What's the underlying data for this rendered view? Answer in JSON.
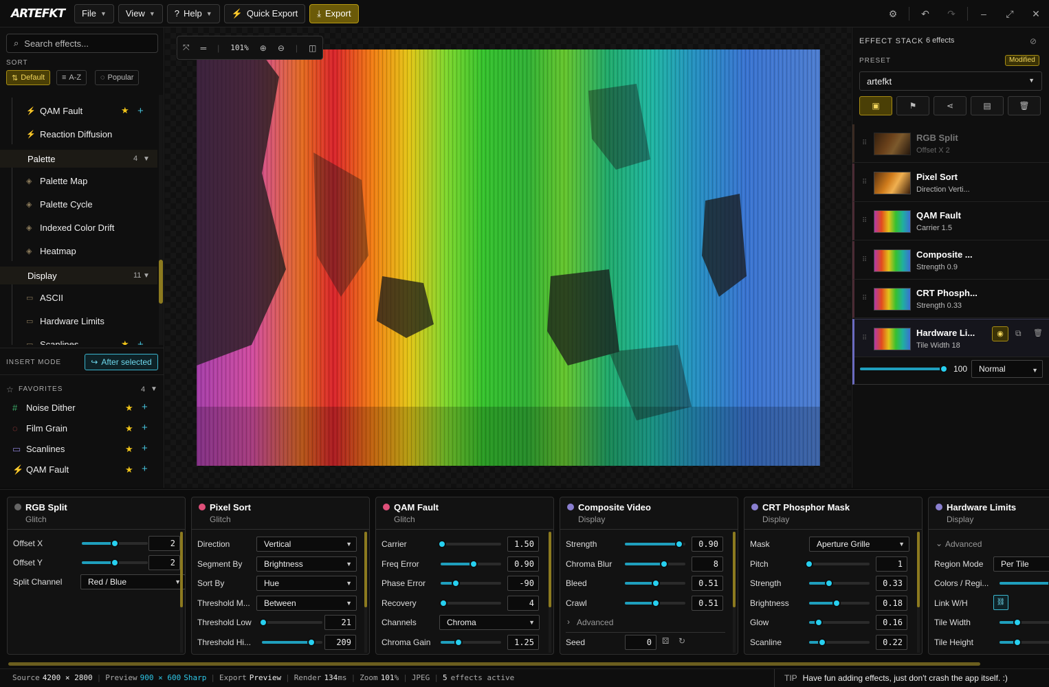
{
  "app": {
    "logo_text": "ARTEFKT"
  },
  "menu": {
    "file": "File",
    "view": "View",
    "help": "Help",
    "quick_export": "Quick Export",
    "export": "Export"
  },
  "colors": {
    "accent_gold": "#b79a13",
    "accent_cyan": "#27d0f0"
  },
  "left": {
    "search_placeholder": "Search effects...",
    "sort_label": "SORT",
    "sort": [
      "Default",
      "A-Z",
      "Popular"
    ],
    "tree": [
      {
        "kind": "item",
        "label": "QAM Fault",
        "icon": "bolt-icon",
        "fav": true
      },
      {
        "kind": "item",
        "label": "Reaction Diffusion",
        "icon": "bolt-icon",
        "fav": false
      },
      {
        "kind": "group",
        "label": "Palette",
        "count": "4"
      },
      {
        "kind": "item",
        "label": "Palette Map",
        "icon": "layers-icon"
      },
      {
        "kind": "item",
        "label": "Palette Cycle",
        "icon": "layers-icon"
      },
      {
        "kind": "item",
        "label": "Indexed Color Drift",
        "icon": "layers-icon"
      },
      {
        "kind": "item",
        "label": "Heatmap",
        "icon": "layers-icon"
      },
      {
        "kind": "group",
        "label": "Display",
        "count": "11"
      },
      {
        "kind": "item",
        "label": "ASCII",
        "icon": "monitor-icon"
      },
      {
        "kind": "item",
        "label": "Hardware Limits",
        "icon": "monitor-icon"
      },
      {
        "kind": "item",
        "label": "Scanlines",
        "icon": "monitor-icon",
        "fav": true
      }
    ],
    "insert_mode_label": "INSERT MODE",
    "insert_mode_value": "After selected",
    "favorites_label": "FAVORITES",
    "favorites_count": "4",
    "favorites": [
      {
        "label": "Noise Dither",
        "icon": "hash-icon",
        "color": "#3cae6a"
      },
      {
        "label": "Film Grain",
        "icon": "film-icon",
        "color": "#d24a4a"
      },
      {
        "label": "Scanlines",
        "icon": "monitor-icon",
        "color": "#8a7fd0"
      },
      {
        "label": "QAM Fault",
        "icon": "bolt-icon",
        "color": "#d24a7a"
      }
    ]
  },
  "canvas": {
    "zoom": "101%"
  },
  "right": {
    "stack_label": "EFFECT STACK",
    "stack_count": "6 effects",
    "preset_label": "PRESET",
    "modified_badge": "Modified",
    "preset_value": "artefkt",
    "stack": [
      {
        "name": "RGB Split",
        "sub": "Offset X 2",
        "dim": true
      },
      {
        "name": "Pixel Sort",
        "sub": "Direction Verti..."
      },
      {
        "name": "QAM Fault",
        "sub": "Carrier 1.5"
      },
      {
        "name": "Composite ...",
        "sub": "Strength 0.9"
      },
      {
        "name": "CRT Phosph...",
        "sub": "Strength 0.33"
      },
      {
        "name": "Hardware Li...",
        "sub": "Tile Width 18",
        "selected": true
      }
    ],
    "opacity": "100",
    "opacity_fraction": 1.0,
    "blend_mode": "Normal"
  },
  "cards": [
    {
      "title": "RGB Split",
      "sub": "Glitch",
      "dot": "#666666",
      "rows": [
        {
          "type": "slider",
          "label": "Offset X",
          "value": "2",
          "frac": 0.5
        },
        {
          "type": "slider",
          "label": "Offset Y",
          "value": "2",
          "frac": 0.5
        },
        {
          "type": "select",
          "label": "Split Channel",
          "value": "Red / Blue"
        }
      ]
    },
    {
      "title": "Pixel Sort",
      "sub": "Glitch",
      "dot": "#e0507a",
      "rows": [
        {
          "type": "select",
          "label": "Direction",
          "value": "Vertical"
        },
        {
          "type": "select",
          "label": "Segment By",
          "value": "Brightness"
        },
        {
          "type": "select",
          "label": "Sort By",
          "value": "Hue"
        },
        {
          "type": "select",
          "label": "Threshold M...",
          "value": "Between"
        },
        {
          "type": "slider",
          "label": "Threshold Low",
          "value": "21",
          "frac": 0.02
        },
        {
          "type": "slider",
          "label": "Threshold Hi...",
          "value": "209",
          "frac": 0.82
        }
      ]
    },
    {
      "title": "QAM Fault",
      "sub": "Glitch",
      "dot": "#e0507a",
      "rows": [
        {
          "type": "slider",
          "label": "Carrier",
          "value": "1.50",
          "frac": 0.02
        },
        {
          "type": "slider",
          "label": "Freq Error",
          "value": "0.90",
          "frac": 0.55
        },
        {
          "type": "slider",
          "label": "Phase Error",
          "value": "-90",
          "frac": 0.25
        },
        {
          "type": "slider",
          "label": "Recovery",
          "value": "4",
          "frac": 0.05
        },
        {
          "type": "select",
          "label": "Channels",
          "value": "Chroma"
        },
        {
          "type": "slider",
          "label": "Chroma Gain",
          "value": "1.25",
          "frac": 0.3
        }
      ]
    },
    {
      "title": "Composite Video",
      "sub": "Display",
      "dot": "#8a7fd0",
      "rows": [
        {
          "type": "slider",
          "label": "Strength",
          "value": "0.90",
          "frac": 0.9
        },
        {
          "type": "slider",
          "label": "Chroma Blur",
          "value": "8",
          "frac": 0.65
        },
        {
          "type": "slider",
          "label": "Bleed",
          "value": "0.51",
          "frac": 0.51
        },
        {
          "type": "slider",
          "label": "Crawl",
          "value": "0.51",
          "frac": 0.51
        },
        {
          "type": "advanced",
          "label": "Advanced"
        },
        {
          "type": "seed",
          "label": "Seed",
          "value": "0"
        }
      ]
    },
    {
      "title": "CRT Phosphor Mask",
      "sub": "Display",
      "dot": "#8a7fd0",
      "rows": [
        {
          "type": "select",
          "label": "Mask",
          "value": "Aperture Grille"
        },
        {
          "type": "slider",
          "label": "Pitch",
          "value": "1",
          "frac": 0.0
        },
        {
          "type": "slider",
          "label": "Strength",
          "value": "0.33",
          "frac": 0.33
        },
        {
          "type": "slider",
          "label": "Brightness",
          "value": "0.18",
          "frac": 0.45
        },
        {
          "type": "slider",
          "label": "Glow",
          "value": "0.16",
          "frac": 0.16
        },
        {
          "type": "slider",
          "label": "Scanline",
          "value": "0.22",
          "frac": 0.22
        }
      ]
    },
    {
      "title": "Hardware Limits",
      "sub": "Display",
      "dot": "#8a7fd0",
      "rows": [
        {
          "type": "advanced",
          "label": "Advanced"
        },
        {
          "type": "select",
          "label": "Region Mode",
          "value": "Per Tile"
        },
        {
          "type": "slider",
          "label": "Colors / Regi...",
          "value": "",
          "frac": 0.9
        },
        {
          "type": "link",
          "label": "Link W/H"
        },
        {
          "type": "slider",
          "label": "Tile Width",
          "value": "",
          "frac": 0.3
        },
        {
          "type": "slider",
          "label": "Tile Height",
          "value": "",
          "frac": 0.3
        }
      ]
    }
  ],
  "status": {
    "source_label": "Source",
    "source_value": "4200 × 2800",
    "preview_label": "Preview",
    "preview_value": "900 × 600",
    "preview_quality": "Sharp",
    "export_label": "Export",
    "export_value": "Preview",
    "render_label": "Render",
    "render_value": "134",
    "render_unit": "ms",
    "zoom_label": "Zoom",
    "zoom_value": "101",
    "zoom_unit": "%",
    "format": "JPEG",
    "effects_count": "5",
    "effects_label": "effects active",
    "tip_label": "TIP",
    "tip_text": "Have fun adding effects, just don't crash the app itself. :)"
  }
}
